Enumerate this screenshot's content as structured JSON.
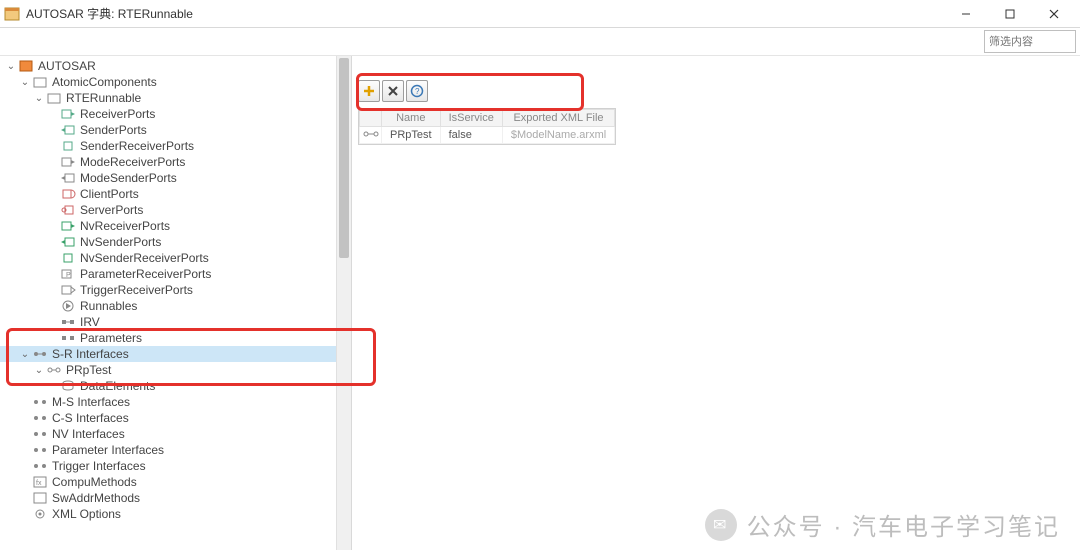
{
  "window": {
    "title": "AUTOSAR 字典: RTERunnable"
  },
  "filter": {
    "placeholder": "筛选内容"
  },
  "tree": {
    "root": "AUTOSAR",
    "atomic": "AtomicComponents",
    "rte": "RTERunnable",
    "items": [
      "ReceiverPorts",
      "SenderPorts",
      "SenderReceiverPorts",
      "ModeReceiverPorts",
      "ModeSenderPorts",
      "ClientPorts",
      "ServerPorts",
      "NvReceiverPorts",
      "NvSenderPorts",
      "NvSenderReceiverPorts",
      "ParameterReceiverPorts",
      "TriggerReceiverPorts",
      "Runnables",
      "IRV",
      "Parameters"
    ],
    "sr_interfaces": "S-R Interfaces",
    "prptest": "PRpTest",
    "dataelements": "DataElements",
    "ms_interfaces": "M-S Interfaces",
    "cs_interfaces": "C-S Interfaces",
    "nv_interfaces": "NV Interfaces",
    "param_interfaces": "Parameter Interfaces",
    "trigger_interfaces": "Trigger Interfaces",
    "compumethods": "CompuMethods",
    "swaddrmethods": "SwAddrMethods",
    "xmloptions": "XML Options"
  },
  "grid": {
    "headers": {
      "name": "Name",
      "isservice": "IsService",
      "exported": "Exported XML File"
    },
    "row": {
      "name": "PRpTest",
      "isservice": "false",
      "exported": "$ModelName.arxml"
    }
  },
  "watermark": {
    "text": "公众号 · 汽车电子学习笔记"
  }
}
